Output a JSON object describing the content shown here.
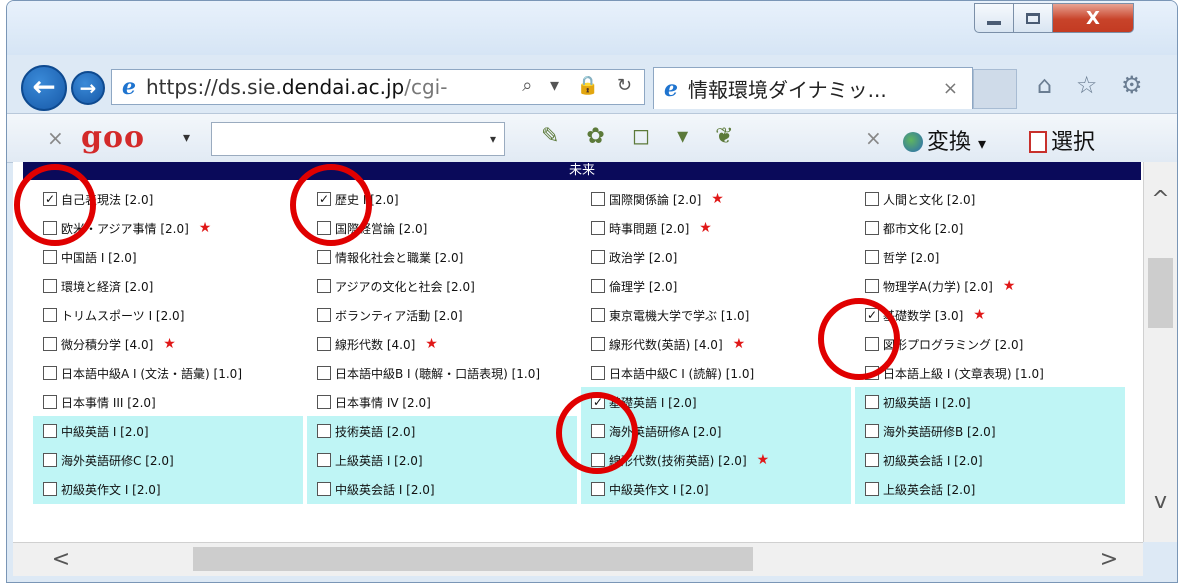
{
  "window": {
    "close_glyph": "X",
    "address_prefix": "https://ds.sie.",
    "address_domain": "dendai.ac.jp",
    "address_rest": "/cgi-",
    "address_icons": "⌕ ▾ 🔒 ↻",
    "tab_title": "情報環境ダイナミッ...",
    "tab_close": "×",
    "right_icons": "⌂ ☆ ⚙"
  },
  "toolbar": {
    "close1": "×",
    "goo_logo": "goo",
    "arrow": "▾",
    "search_dd": "▾",
    "icons": "✎ ✿ ◻ ▾ ❦",
    "close2": "×",
    "henkan_label": "変換",
    "henkan_arrow": "▾",
    "sentaku_label": "選択"
  },
  "content": {
    "header": "未来"
  },
  "courses": [
    {
      "label": "自己表現法 [2.0]",
      "checked": true,
      "star": false,
      "hl": false
    },
    {
      "label": "歴史 I [2.0]",
      "checked": true,
      "star": false,
      "hl": false
    },
    {
      "label": "国際関係論 [2.0]",
      "checked": false,
      "star": true,
      "hl": false
    },
    {
      "label": "人間と文化 [2.0]",
      "checked": false,
      "star": false,
      "hl": false
    },
    {
      "label": "欧米・アジア事情 [2.0]",
      "checked": false,
      "star": true,
      "hl": false
    },
    {
      "label": "国際経営論 [2.0]",
      "checked": false,
      "star": false,
      "hl": false
    },
    {
      "label": "時事問題 [2.0]",
      "checked": false,
      "star": true,
      "hl": false
    },
    {
      "label": "都市文化 [2.0]",
      "checked": false,
      "star": false,
      "hl": false
    },
    {
      "label": "中国語 I [2.0]",
      "checked": false,
      "star": false,
      "hl": false
    },
    {
      "label": "情報化社会と職業 [2.0]",
      "checked": false,
      "star": false,
      "hl": false
    },
    {
      "label": "政治学 [2.0]",
      "checked": false,
      "star": false,
      "hl": false
    },
    {
      "label": "哲学 [2.0]",
      "checked": false,
      "star": false,
      "hl": false
    },
    {
      "label": "環境と経済 [2.0]",
      "checked": false,
      "star": false,
      "hl": false
    },
    {
      "label": "アジアの文化と社会 [2.0]",
      "checked": false,
      "star": false,
      "hl": false
    },
    {
      "label": "倫理学 [2.0]",
      "checked": false,
      "star": false,
      "hl": false
    },
    {
      "label": "物理学A(力学) [2.0]",
      "checked": false,
      "star": true,
      "hl": false
    },
    {
      "label": "トリムスポーツ I [2.0]",
      "checked": false,
      "star": false,
      "hl": false
    },
    {
      "label": "ボランティア活動 [2.0]",
      "checked": false,
      "star": false,
      "hl": false
    },
    {
      "label": "東京電機大学で学ぶ [1.0]",
      "checked": false,
      "star": false,
      "hl": false
    },
    {
      "label": "基礎数学 [3.0]",
      "checked": true,
      "star": true,
      "hl": false
    },
    {
      "label": "微分積分学 [4.0]",
      "checked": false,
      "star": true,
      "hl": false
    },
    {
      "label": "線形代数 [4.0]",
      "checked": false,
      "star": true,
      "hl": false
    },
    {
      "label": "線形代数(英語) [4.0]",
      "checked": false,
      "star": true,
      "hl": false
    },
    {
      "label": "図形プログラミング [2.0]",
      "checked": false,
      "star": false,
      "hl": false
    },
    {
      "label": "日本語中級A I (文法・語彙) [1.0]",
      "checked": false,
      "star": false,
      "hl": false
    },
    {
      "label": "日本語中級B I (聴解・口語表現) [1.0]",
      "checked": false,
      "star": false,
      "hl": false
    },
    {
      "label": "日本語中級C I (読解) [1.0]",
      "checked": false,
      "star": false,
      "hl": false
    },
    {
      "label": "日本語上級 I (文章表現) [1.0]",
      "checked": false,
      "star": false,
      "hl": false
    },
    {
      "label": "日本事情 III [2.0]",
      "checked": false,
      "star": false,
      "hl": false
    },
    {
      "label": "日本事情 IV [2.0]",
      "checked": false,
      "star": false,
      "hl": false
    },
    {
      "label": "基礎英語 I [2.0]",
      "checked": true,
      "star": false,
      "hl": true
    },
    {
      "label": "初級英語 I [2.0]",
      "checked": false,
      "star": false,
      "hl": true
    },
    {
      "label": "中級英語 I [2.0]",
      "checked": false,
      "star": false,
      "hl": true
    },
    {
      "label": "技術英語 [2.0]",
      "checked": false,
      "star": false,
      "hl": true
    },
    {
      "label": "海外英語研修A [2.0]",
      "checked": false,
      "star": false,
      "hl": true
    },
    {
      "label": "海外英語研修B [2.0]",
      "checked": false,
      "star": false,
      "hl": true
    },
    {
      "label": "海外英語研修C [2.0]",
      "checked": false,
      "star": false,
      "hl": true
    },
    {
      "label": "上級英語 I [2.0]",
      "checked": false,
      "star": false,
      "hl": true
    },
    {
      "label": "線形代数(技術英語) [2.0]",
      "checked": false,
      "star": true,
      "hl": true
    },
    {
      "label": "初級英会話 I [2.0]",
      "checked": false,
      "star": false,
      "hl": true
    },
    {
      "label": "初級英作文 I [2.0]",
      "checked": false,
      "star": false,
      "hl": true
    },
    {
      "label": "中級英会話 I [2.0]",
      "checked": false,
      "star": false,
      "hl": true
    },
    {
      "label": "中級英作文 I [2.0]",
      "checked": false,
      "star": false,
      "hl": true
    },
    {
      "label": "上級英会話 [2.0]",
      "checked": false,
      "star": false,
      "hl": true
    }
  ],
  "glyphs": {
    "check": "✓",
    "star": "★",
    "scroll_up": "^",
    "scroll_down": "v",
    "scroll_left": "<",
    "scroll_right": ">",
    "back": "←",
    "forward": "→"
  },
  "colors": {
    "highlight": "#bff5f5",
    "circle": "#e00000",
    "star": "#e01818",
    "header_bg": "#0a0a5a"
  }
}
